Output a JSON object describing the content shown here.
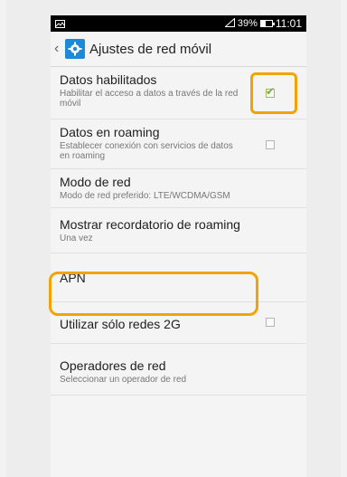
{
  "status_bar": {
    "signal_icon": "signal-icon",
    "battery_percent": "39%",
    "battery_level": 0.39,
    "time": "11:01"
  },
  "app_bar": {
    "back_icon": "chevron-left-icon",
    "icon": "gear-icon",
    "title": "Ajustes de red móvil"
  },
  "settings": [
    {
      "title": "Datos habilitados",
      "summary": "Habilitar el acceso a datos a través de la red móvil",
      "checkbox": true,
      "checked": true
    },
    {
      "title": "Datos en roaming",
      "summary": "Establecer conexión con servicios de datos en roaming",
      "checkbox": true,
      "checked": false
    },
    {
      "title": "Modo de red",
      "summary": "Modo de red preferido: LTE/WCDMA/GSM"
    },
    {
      "title": "Mostrar recordatorio de roaming",
      "summary": "Una vez"
    },
    {
      "title": "APN"
    },
    {
      "title": "Utilizar sólo redes 2G",
      "checkbox": true,
      "checked": false
    },
    {
      "title": "Operadores de red",
      "summary": "Seleccionar un operador de red"
    }
  ],
  "annotations": {
    "highlight_color": "#f2a300"
  }
}
